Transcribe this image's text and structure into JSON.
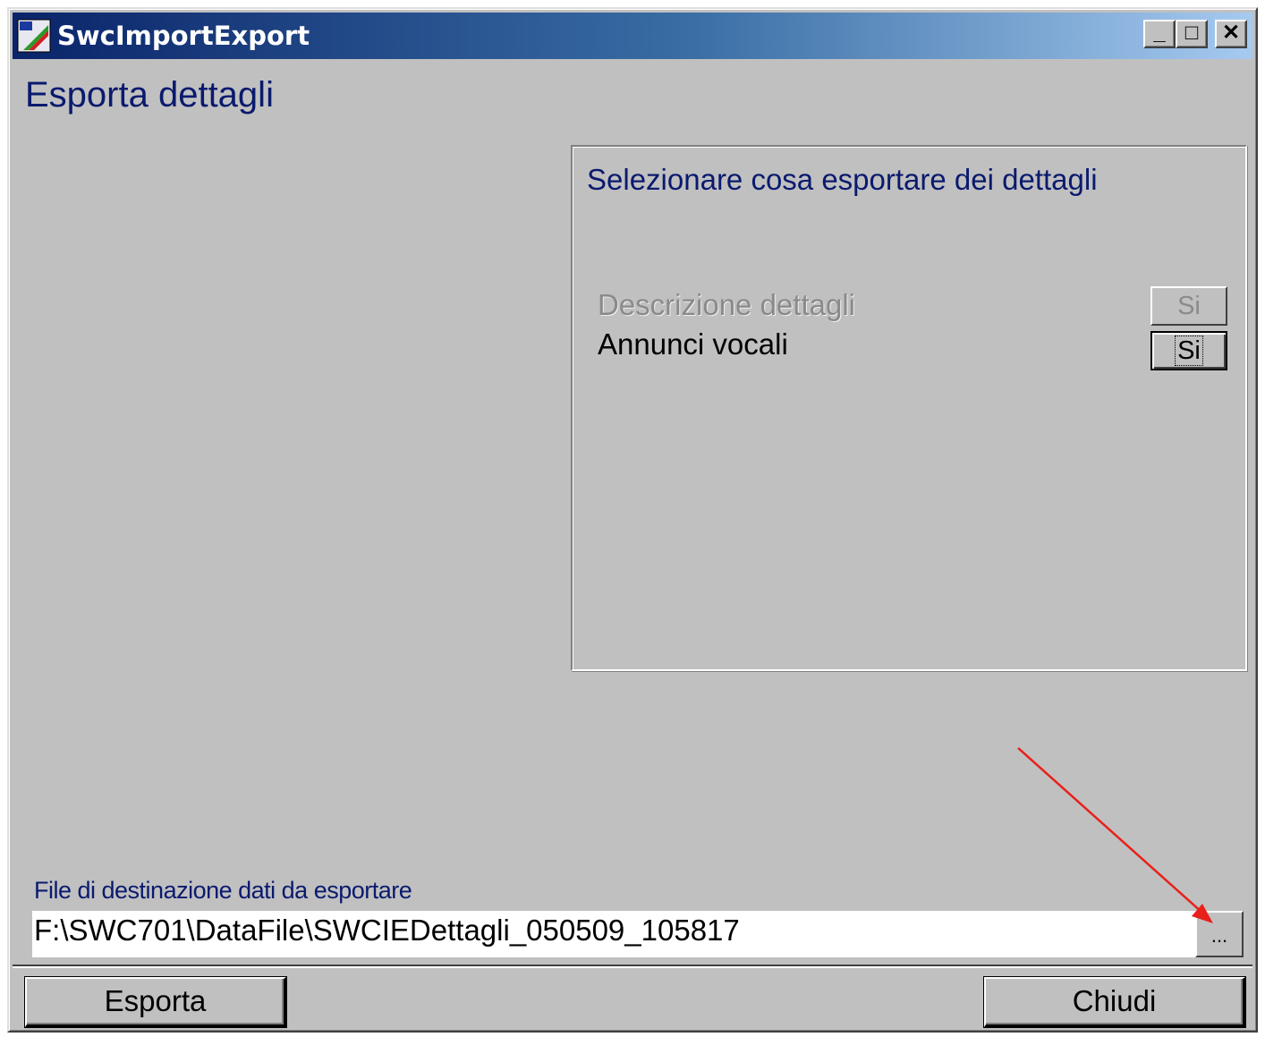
{
  "window": {
    "title": "SwcImportExport",
    "minimize_glyph": "_",
    "maximize_glyph": "□",
    "close_glyph": "✕"
  },
  "page": {
    "title": "Esporta dettagli"
  },
  "selection_group": {
    "title": "Selezionare cosa esportare dei dettagli",
    "rows": [
      {
        "label": "Descrizione dettagli",
        "value": "Si",
        "enabled": false
      },
      {
        "label": "Annunci vocali",
        "value": "Si",
        "enabled": true,
        "focused": true
      }
    ]
  },
  "destination": {
    "label": "File di destinazione dati da esportare",
    "value": "F:\\SWC701\\DataFile\\SWCIEDettagli_050509_105817",
    "browse_label": "..."
  },
  "footer": {
    "export_label": "Esporta",
    "close_label": "Chiudi"
  },
  "colors": {
    "annotation_arrow": "#e8201c",
    "title_text": "#0a1a6e"
  }
}
